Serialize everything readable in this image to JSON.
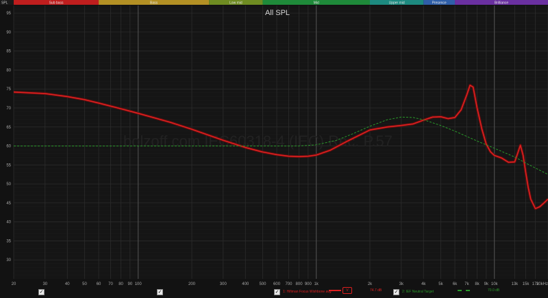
{
  "window": {
    "corner_label": "SPL",
    "bg_color": "#121212",
    "plot_bg": "#151515"
  },
  "bands": [
    {
      "label": "Sub bass",
      "from": 20,
      "to": 60,
      "color": "#c01e1e"
    },
    {
      "label": "Bass",
      "from": 60,
      "to": 250,
      "color": "#b39024"
    },
    {
      "label": "Low mid",
      "from": 250,
      "to": 500,
      "color": "#6f8c22"
    },
    {
      "label": "Mid",
      "from": 500,
      "to": 2000,
      "color": "#1f8a3a"
    },
    {
      "label": "Upper mid",
      "from": 2000,
      "to": 4000,
      "color": "#1d8a80"
    },
    {
      "label": "Presence",
      "from": 4000,
      "to": 6000,
      "color": "#2f5fa8"
    },
    {
      "label": "Brilliance",
      "from": 6000,
      "to": 20000,
      "color": "#6a30a0"
    }
  ],
  "legend": {
    "items": [
      {
        "name": "",
        "color": "#5a0e0e",
        "checked": true
      },
      {
        "name": "",
        "color": "#5a0e0e",
        "checked": true
      },
      {
        "name": "1: Hifiman Focus Wishbone avg",
        "color": "#e02020",
        "value_box": "V",
        "value": "74.7 dB",
        "checked": true
      },
      {
        "name": "2: IEF Neutral Target",
        "color": "#2a9a2a",
        "value": "70.0 dB",
        "checked": true
      }
    ]
  },
  "chart_data": {
    "type": "line",
    "title": "All SPL",
    "watermark": "bolzoff.com IEC60318-4 (IEC) Rec. P.57",
    "xscale": "log",
    "xlim": [
      20,
      20000
    ],
    "ylim": [
      25,
      97
    ],
    "y_ticks": [
      30,
      35,
      40,
      45,
      50,
      55,
      60,
      65,
      70,
      75,
      80,
      85,
      90,
      95
    ],
    "x_ticks": [
      {
        "v": 20,
        "label": "20"
      },
      {
        "v": 30,
        "label": "30"
      },
      {
        "v": 40,
        "label": "40"
      },
      {
        "v": 50,
        "label": "50"
      },
      {
        "v": 60,
        "label": "60"
      },
      {
        "v": 70,
        "label": "70"
      },
      {
        "v": 80,
        "label": "80"
      },
      {
        "v": 90,
        "label": "90"
      },
      {
        "v": 100,
        "label": "100"
      },
      {
        "v": 200,
        "label": "200"
      },
      {
        "v": 300,
        "label": "300"
      },
      {
        "v": 400,
        "label": "400"
      },
      {
        "v": 500,
        "label": "500"
      },
      {
        "v": 600,
        "label": "600"
      },
      {
        "v": 700,
        "label": "700"
      },
      {
        "v": 800,
        "label": "800"
      },
      {
        "v": 900,
        "label": "900"
      },
      {
        "v": 1000,
        "label": "1k"
      },
      {
        "v": 2000,
        "label": "2k"
      },
      {
        "v": 3000,
        "label": "3k"
      },
      {
        "v": 4000,
        "label": "4k"
      },
      {
        "v": 5000,
        "label": "5k"
      },
      {
        "v": 6000,
        "label": "6k"
      },
      {
        "v": 7000,
        "label": "7k"
      },
      {
        "v": 8000,
        "label": "8k"
      },
      {
        "v": 9000,
        "label": "9k"
      },
      {
        "v": 10000,
        "label": "10k"
      },
      {
        "v": 13000,
        "label": "13k"
      },
      {
        "v": 15000,
        "label": "15k"
      },
      {
        "v": 17000,
        "label": "17k"
      },
      {
        "v": 20000,
        "label": "20kHz"
      }
    ],
    "grid": true,
    "series": [
      {
        "name": "1: Hifiman Focus Wishbone avg",
        "color": "#e02020",
        "style": "solid",
        "x": [
          20,
          30,
          40,
          50,
          60,
          80,
          100,
          150,
          200,
          300,
          400,
          500,
          600,
          700,
          800,
          900,
          1000,
          1200,
          1500,
          2000,
          2500,
          3000,
          3500,
          4000,
          4500,
          5000,
          5500,
          6000,
          6500,
          7000,
          7300,
          7600,
          8000,
          8500,
          9000,
          9500,
          10000,
          11000,
          12000,
          13000,
          13500,
          14000,
          14500,
          15000,
          15500,
          16000,
          17000,
          18000,
          19000,
          20000
        ],
        "y": [
          74.2,
          73.8,
          73.0,
          72.2,
          71.3,
          69.8,
          68.6,
          66.3,
          64.4,
          61.5,
          59.6,
          58.4,
          57.7,
          57.3,
          57.2,
          57.3,
          57.6,
          58.9,
          61.3,
          64.2,
          65.0,
          65.4,
          65.8,
          66.8,
          67.6,
          67.7,
          67.2,
          67.5,
          69.5,
          73.5,
          76.0,
          75.5,
          70.0,
          64.5,
          60.5,
          58.5,
          57.5,
          56.8,
          55.7,
          55.8,
          58.0,
          60.2,
          57.5,
          53.0,
          49.0,
          46.0,
          43.5,
          44.0,
          45.0,
          46.0
        ]
      },
      {
        "name": "2: IEF Neutral Target",
        "color": "#2a9a2a",
        "style": "dashed",
        "x": [
          20,
          50,
          100,
          200,
          400,
          600,
          800,
          1000,
          1300,
          1600,
          2000,
          2500,
          3000,
          3500,
          4000,
          5000,
          6000,
          8000,
          10000,
          13000,
          16000,
          20000
        ],
        "y": [
          60.0,
          60.0,
          60.0,
          60.0,
          60.0,
          60.0,
          60.0,
          60.3,
          61.5,
          63.2,
          65.2,
          66.9,
          67.6,
          67.5,
          66.9,
          65.4,
          63.9,
          61.3,
          59.4,
          57.1,
          54.8,
          52.5
        ]
      }
    ]
  }
}
